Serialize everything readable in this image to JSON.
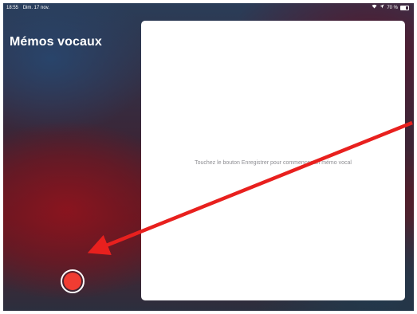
{
  "status_bar": {
    "time": "18:55",
    "date": "Dim. 17 nov.",
    "battery": "70 %",
    "battery_level": 0.7,
    "icons": [
      "wifi-icon",
      "location-icon",
      "battery-icon"
    ]
  },
  "app": {
    "title": "Mémos vocaux"
  },
  "detail": {
    "empty_message": "Touchez le bouton Enregistrer pour commencer un mémo vocal"
  },
  "record_button": {
    "icon": "record-icon",
    "color": "#f03c32"
  },
  "annotation": {
    "icon": "arrow-icon",
    "color": "#e8201e"
  }
}
